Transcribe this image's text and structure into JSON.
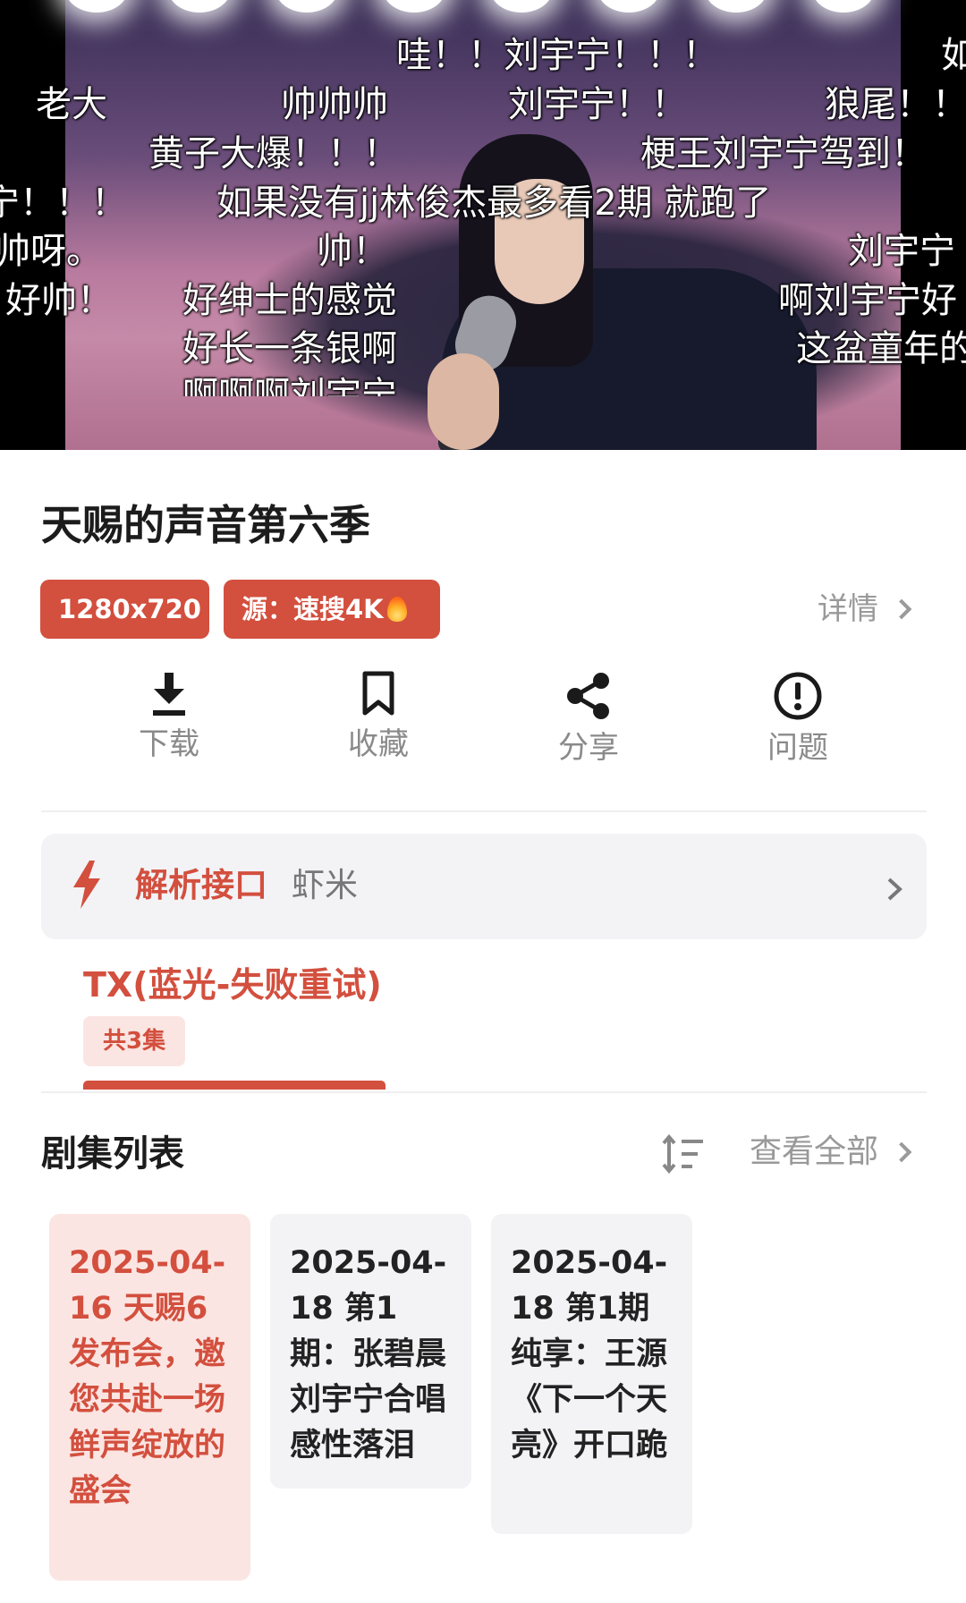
{
  "player": {
    "danmaku": [
      "哇！！刘宇宁！！！",
      "如",
      "老大",
      "帅帅帅",
      "刘宇宁！！",
      "狼尾！！",
      "黄子大爆！！！",
      "梗王刘宇宁驾到！",
      "宁！！！",
      "如果没有jj林俊杰最多看2期 就跑了",
      "帅呀。",
      "帅！",
      "刘宇宁",
      "好帅！",
      "好绅士的感觉",
      "啊刘宇宁好",
      "好长一条银啊",
      "这盆童年的",
      "啊啊啊刘宇宁"
    ]
  },
  "show": {
    "title": "天赐的声音第六季",
    "resolution": "1280x720",
    "source_label": "源：速搜4K",
    "source_icon": "flame-icon",
    "detail_link": "详情"
  },
  "actions": {
    "download": {
      "label": "下载",
      "icon": "download-icon"
    },
    "favorite": {
      "label": "收藏",
      "icon": "bookmark-icon"
    },
    "share": {
      "label": "分享",
      "icon": "share-icon"
    },
    "report": {
      "label": "问题",
      "icon": "exclamation-circle-icon"
    }
  },
  "parse": {
    "label": "解析接口",
    "value": "虾米",
    "icon": "lightning-icon"
  },
  "source": {
    "name": "TX(蓝光-失败重试)",
    "episode_count": "共3集"
  },
  "episodes": {
    "title": "剧集列表",
    "view_all": "查看全部",
    "items": [
      {
        "label": "2025-04-16 天赐6发布会，邀您共赴一场鲜声绽放的盛会",
        "active": true
      },
      {
        "label": "2025-04-18 第1期：张碧晨刘宇宁合唱感性落泪",
        "active": false
      },
      {
        "label": "2025-04-18 第1期纯享：王源《下一个天亮》开口跪",
        "active": false
      }
    ]
  },
  "colors": {
    "accent": "#d34f3e",
    "accent_light": "#fbe5e2",
    "card_bg": "#f3f3f6",
    "muted_text": "#999999"
  }
}
